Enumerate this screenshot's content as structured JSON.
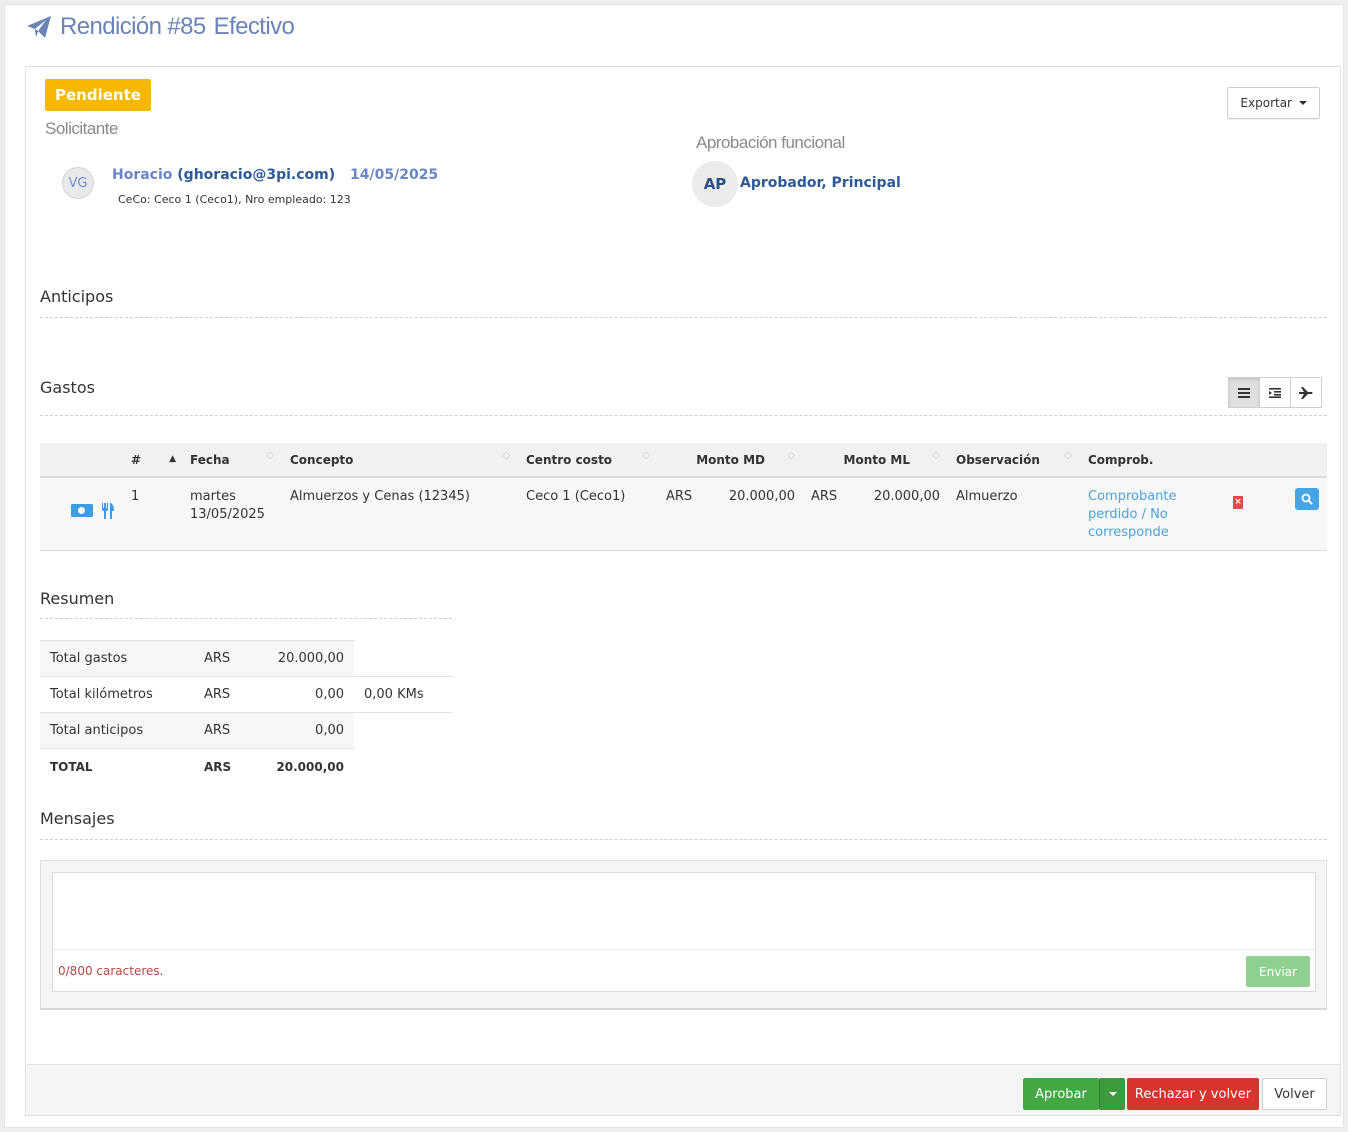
{
  "header": {
    "title": "Rendición #85",
    "type": "Efectivo",
    "icon": "paper-plane-icon"
  },
  "status_badge": "Pendiente",
  "export_button": "Exportar",
  "requester": {
    "section_title": "Solicitante",
    "initials": "VG",
    "name": "Horacio",
    "email": "(ghoracio@3pi.com)",
    "date": "14/05/2025",
    "details": "CeCo: Ceco 1 (Ceco1), Nro empleado: 123"
  },
  "approval": {
    "section_title": "Aprobación funcional",
    "initials": "AP",
    "name": "Aprobador, Principal"
  },
  "anticipos": {
    "title": "Anticipos"
  },
  "gastos": {
    "title": "Gastos",
    "view_buttons": [
      "list-icon",
      "indent-icon",
      "plane-icon"
    ],
    "columns": [
      "#",
      "Fecha",
      "Concepto",
      "Centro costo",
      "Monto MD",
      "Monto ML",
      "Observación",
      "Comprob."
    ],
    "rows": [
      {
        "num": "1",
        "fecha_day": "martes",
        "fecha_date": "13/05/2025",
        "concepto": "Almuerzos y Cenas (12345)",
        "centro_costo": "Ceco 1 (Ceco1)",
        "moneda_md": "ARS",
        "monto_md": "20.000,00",
        "moneda_ml": "ARS",
        "monto_ml": "20.000,00",
        "observacion": "Almuerzo",
        "comprobante": "Comprobante perdido / No corresponde",
        "icons": [
          "money-icon",
          "cutlery-icon"
        ]
      }
    ]
  },
  "resumen": {
    "title": "Resumen",
    "rows": [
      {
        "label": "Total gastos",
        "currency": "ARS",
        "amount": "20.000,00",
        "extra": ""
      },
      {
        "label": "Total kilómetros",
        "currency": "ARS",
        "amount": "0,00",
        "extra": "0,00 KMs"
      },
      {
        "label": "Total anticipos",
        "currency": "ARS",
        "amount": "0,00",
        "extra": ""
      }
    ],
    "total": {
      "label": "TOTAL",
      "currency": "ARS",
      "amount": "20.000,00"
    }
  },
  "mensajes": {
    "title": "Mensajes",
    "char_count": "0/800 caracteres.",
    "send_button": "Enviar"
  },
  "footer": {
    "approve": "Aprobar",
    "reject": "Rechazar y volver",
    "back": "Volver"
  },
  "colors": {
    "pending": "#f6b800",
    "approve": "#43a843",
    "reject": "#d8332f",
    "link": "#4aa3df",
    "title": "#6a83b8"
  }
}
